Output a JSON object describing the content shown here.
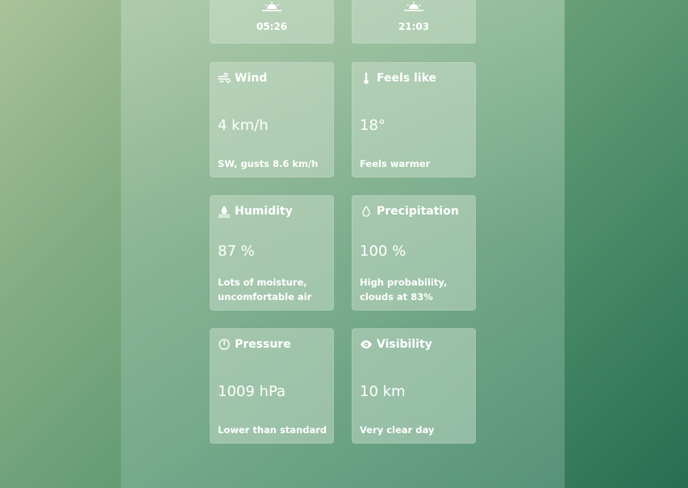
{
  "sun": {
    "sunrise": {
      "time": "05:26",
      "icon": "sunrise-icon"
    },
    "sunset": {
      "time": "21:03",
      "icon": "sunset-icon"
    }
  },
  "cards": {
    "wind": {
      "title": "Wind",
      "value": "4 km/h",
      "desc": "SW, gusts 8.6 km/h",
      "icon": "wind-icon"
    },
    "feels_like": {
      "title": "Feels like",
      "value": "18°",
      "desc": "Feels warmer",
      "icon": "thermometer-icon"
    },
    "humidity": {
      "title": "Humidity",
      "value": "87 %",
      "desc": "Lots of moisture, uncomfortable air",
      "icon": "humidity-icon"
    },
    "precipitation": {
      "title": "Precipitation",
      "value": "100 %",
      "desc": "High probability, clouds at 83%",
      "icon": "droplet-icon"
    },
    "pressure": {
      "title": "Pressure",
      "value": "1009 hPa",
      "desc": "Lower than standard",
      "icon": "gauge-icon"
    },
    "visibility": {
      "title": "Visibility",
      "value": "10 km",
      "desc": "Very clear day",
      "icon": "eye-icon"
    }
  }
}
